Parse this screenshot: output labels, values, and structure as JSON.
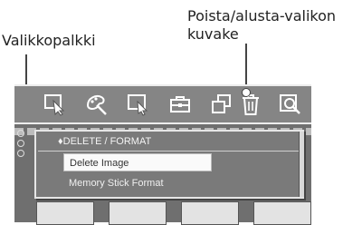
{
  "callouts": {
    "menubar_label": "Valikkopalkki",
    "delete_icon_label_line1": "Poista/alusta-valikon",
    "delete_icon_label_line2": "kuvake"
  },
  "menubar": {
    "icons": [
      "select-icon",
      "paint-icon",
      "select-frame-icon",
      "toolbox-icon",
      "copy-icon",
      "trash-icon",
      "zoom-icon"
    ]
  },
  "menu": {
    "title": "DELETE / FORMAT",
    "items": [
      {
        "label": "Delete Image",
        "selected": true
      },
      {
        "label": "Memory Stick Format",
        "selected": false
      }
    ]
  },
  "colors": {
    "screen_bg": "#7c7c7c",
    "menubar_bg": "#858585",
    "icon_stroke": "#ffffff",
    "selected_item_bg": "#fafafa"
  }
}
